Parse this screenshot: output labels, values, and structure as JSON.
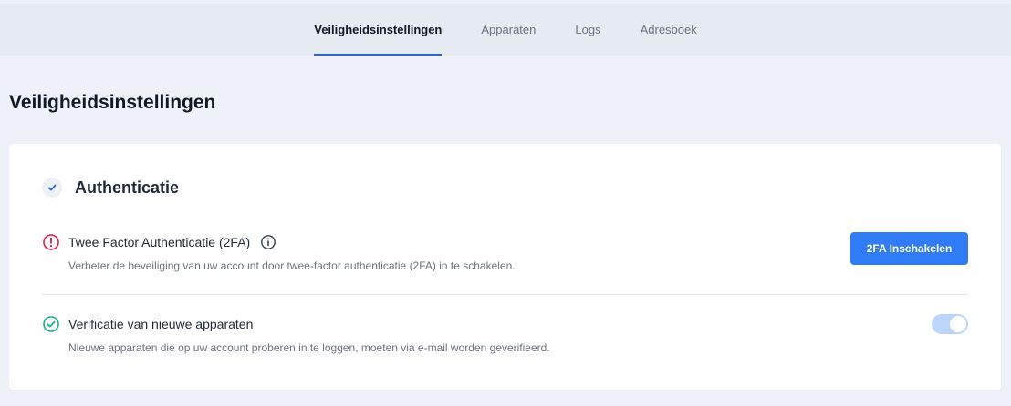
{
  "nav": {
    "tabs": [
      {
        "label": "Veiligheidsinstellingen",
        "active": true
      },
      {
        "label": "Apparaten",
        "active": false
      },
      {
        "label": "Logs",
        "active": false
      },
      {
        "label": "Adresboek",
        "active": false
      }
    ]
  },
  "page": {
    "title": "Veiligheidsinstellingen"
  },
  "section": {
    "title": "Authenticatie",
    "icon": "check-icon",
    "items": [
      {
        "icon": "alert-circle-icon",
        "icon_color": "#e11d48",
        "title": "Twee Factor Authenticatie (2FA)",
        "info_icon": "info-icon",
        "description": "Verbeter de beveiliging van uw account door twee-factor authenticatie (2FA) in te schakelen.",
        "action_label": "2FA Inschakelen",
        "action_color": "#2f7cf6"
      },
      {
        "icon": "check-circle-icon",
        "icon_color": "#10b981",
        "title": "Verificatie van nieuwe apparaten",
        "description": "Nieuwe apparaten die op uw account proberen in te loggen, moeten via e-mail worden geverifieerd.",
        "toggle_on": true
      }
    ]
  },
  "colors": {
    "accent": "#2563eb",
    "background": "#eef2f8"
  }
}
